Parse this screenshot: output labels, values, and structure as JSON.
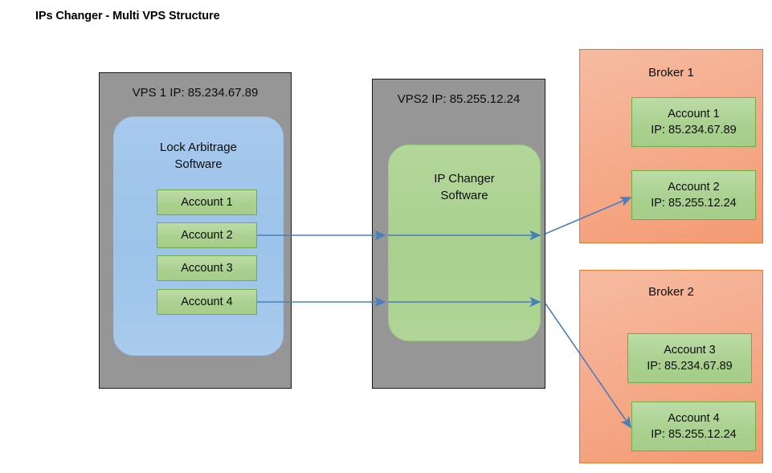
{
  "title": "IPs Changer - Multi VPS Structure",
  "vps1": {
    "label": "VPS 1 IP: 85.234.67.89",
    "software": "Lock Arbitrage\nSoftware",
    "software_line1": "Lock Arbitrage",
    "software_line2": "Software",
    "accounts": [
      {
        "name": "Account 1"
      },
      {
        "name": "Account 2"
      },
      {
        "name": "Account 3"
      },
      {
        "name": "Account 4"
      }
    ]
  },
  "vps2": {
    "label": "VPS2 IP: 85.255.12.24",
    "software_line1": "IP Changer",
    "software_line2": "Software"
  },
  "broker1": {
    "label": "Broker 1",
    "accounts": [
      {
        "name": "Account 1",
        "ip": "IP: 85.234.67.89"
      },
      {
        "name": "Account 2",
        "ip": "IP: 85.255.12.24"
      }
    ]
  },
  "broker2": {
    "label": "Broker 2",
    "accounts": [
      {
        "name": "Account 3",
        "ip": "IP: 85.234.67.89"
      },
      {
        "name": "Account 4",
        "ip": "IP: 85.255.12.24"
      }
    ]
  },
  "colors": {
    "vps_grey": "#969696",
    "software_blue": "#9cc3ea",
    "software_green": "#a9d08e",
    "account_green": "#a9d08e",
    "account_green_border": "#71ad47",
    "broker_orange": "#f5ac8d",
    "broker_orange_border": "#e8772e",
    "arrow_blue": "#4a7ebb",
    "text": "#0d0d0d"
  },
  "connections": [
    {
      "from": "vps1.account2",
      "to": "vps2.software",
      "kind": "arrow"
    },
    {
      "from": "vps2.software",
      "to": "broker1.account2",
      "kind": "arrow"
    },
    {
      "from": "vps1.account4",
      "to": "vps2.software",
      "kind": "arrow"
    },
    {
      "from": "vps2.software",
      "to": "broker2.account4",
      "kind": "arrow"
    }
  ]
}
